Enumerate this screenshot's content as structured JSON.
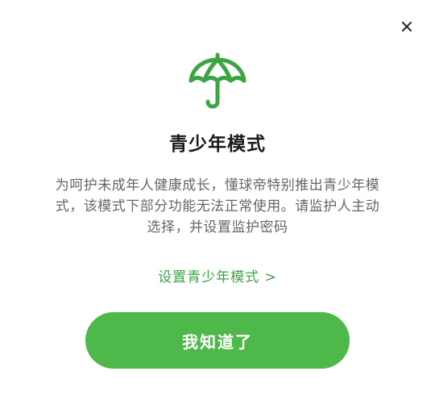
{
  "dialog": {
    "close_icon": "close-icon",
    "hero_icon": "umbrella-icon",
    "title": "青少年模式",
    "description": "为呵护未成年人健康成长，懂球帝特别推出青少年模式，该模式下部分功能无法正常使用。请监护人主动选择，并设置监护密码",
    "setup_link": "设置青少年模式 >",
    "ack_button": "我知道了"
  },
  "colors": {
    "accent": "#3aa541",
    "button_bg": "#4fb84a",
    "title_text": "#1a1a1a",
    "body_text": "#666666",
    "background": "#ffffff"
  }
}
